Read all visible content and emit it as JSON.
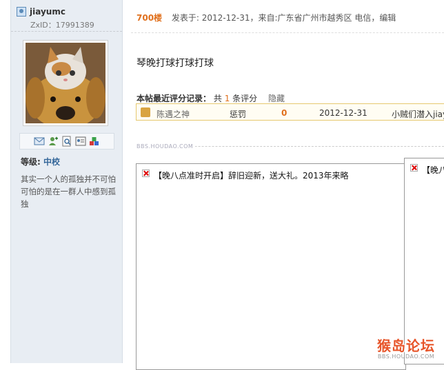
{
  "author": {
    "username": "jiayumc",
    "zxid": "ZxID：17991389",
    "level_label": "等级:",
    "level_value": "中校",
    "signature": "其实一个人的孤独并不可怕　可怕的是在一群人中感到孤独"
  },
  "post": {
    "floor": "700楼",
    "meta": "发表于: 2012-12-31，来自:广东省广州市越秀区 电信，编辑",
    "content": "琴晚打球打球打球"
  },
  "rating": {
    "title_bold": "本帖最近评分记录：",
    "title_prefix": "共",
    "title_count": "1",
    "title_suffix": "条评分",
    "hide": "隐藏",
    "row": {
      "user": "陈遇之神",
      "action": "惩罚",
      "score": "0",
      "date": "2012-12-31",
      "reason": "小贼们潜入jiay"
    }
  },
  "watermark_small": "BBS.HOUDAO.COM",
  "broken_images": [
    "【晚八点准时开启】辞旧迎新，送大礼。2013年来略",
    "【晚八"
  ],
  "logo": {
    "main": "猴岛论坛",
    "sub": "BBS.HOUDAO.COM"
  },
  "colors": {
    "accent": "#e0701d",
    "sidebar": "#e8edf3",
    "rating_border": "#e6c86f"
  }
}
